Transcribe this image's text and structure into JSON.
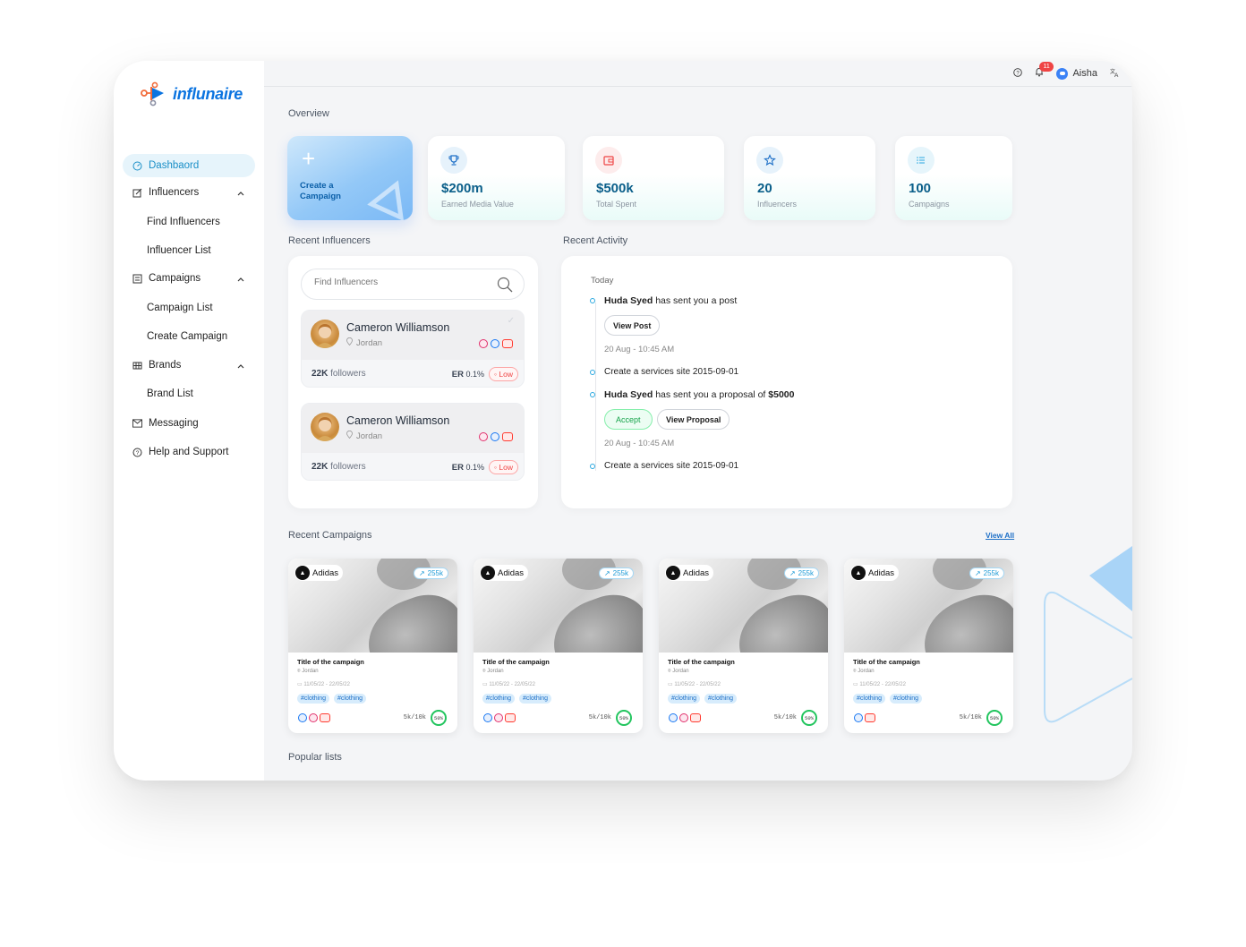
{
  "app": {
    "name": "influnaire"
  },
  "sidebar": {
    "items": [
      {
        "label": "Dashbaord"
      },
      {
        "label": "Influencers"
      },
      {
        "label": "Find Influencers"
      },
      {
        "label": "Influencer List"
      },
      {
        "label": "Campaigns"
      },
      {
        "label": "Campaign List"
      },
      {
        "label": "Create Campaign"
      },
      {
        "label": "Brands"
      },
      {
        "label": "Brand List"
      },
      {
        "label": "Messaging"
      },
      {
        "label": "Help and Support"
      }
    ]
  },
  "topbar": {
    "notification_count": "11",
    "user_name": "Aisha"
  },
  "overview": {
    "title": "Overview",
    "create_label": "Create a Campaign",
    "stats": [
      {
        "value": "$200m",
        "label": "Earned Media Value",
        "icon": "trophy-icon"
      },
      {
        "value": "$500k",
        "label": "Total Spent",
        "icon": "wallet-icon"
      },
      {
        "value": "20",
        "label": "Influencers",
        "icon": "star-icon"
      },
      {
        "value": "100",
        "label": "Campaigns",
        "icon": "list-icon"
      }
    ]
  },
  "recent_influencers": {
    "title": "Recent Influencers",
    "search_placeholder": "Find Influencers",
    "cards": [
      {
        "name": "Cameron Williamson",
        "location": "Jordan",
        "followers": "22K",
        "followers_label": "followers",
        "er_label": "ER",
        "er_value": "0.1%",
        "level": "Low"
      },
      {
        "name": "Cameron Williamson",
        "location": "Jordan",
        "followers": "22K",
        "followers_label": "followers",
        "er_label": "ER",
        "er_value": "0.1%",
        "level": "Low"
      }
    ]
  },
  "recent_activity": {
    "title": "Recent Activity",
    "day": "Today",
    "items": [
      {
        "actor": "Huda Syed",
        "text": "has sent you a post",
        "button": "View Post",
        "time": "20 Aug - 10:45 AM"
      },
      {
        "text": "Create a services site 2015-09-01"
      },
      {
        "actor": "Huda Syed",
        "text": "has sent you a proposal of",
        "amount": "$5000",
        "accept": "Accept",
        "button": "View Proposal",
        "time": "20 Aug - 10:45 AM"
      },
      {
        "text": "Create a services site 2015-09-01"
      }
    ]
  },
  "recent_campaigns": {
    "title": "Recent Campaigns",
    "view_all": "View All",
    "cards": [
      {
        "brand": "Adidas",
        "reach": "255k",
        "title": "Title of the campaign",
        "location": "Jordan",
        "dates": "11/05/22 - 22/05/22",
        "tags": [
          "#clothing",
          "#clothing"
        ],
        "progress": "5k/10k",
        "percent": "50%"
      },
      {
        "brand": "Adidas",
        "reach": "255k",
        "title": "Title of the campaign",
        "location": "Jordan",
        "dates": "11/05/22 - 22/05/22",
        "tags": [
          "#clothing",
          "#clothing"
        ],
        "progress": "5k/10k",
        "percent": "50%"
      },
      {
        "brand": "Adidas",
        "reach": "255k",
        "title": "Title of the campaign",
        "location": "Jordan",
        "dates": "11/05/22 - 22/05/22",
        "tags": [
          "#clothing",
          "#clothing"
        ],
        "progress": "5k/10k",
        "percent": "50%"
      },
      {
        "brand": "Adidas",
        "reach": "255k",
        "title": "Title of the campaign",
        "location": "Jordan",
        "dates": "11/05/22 - 22/05/22",
        "tags": [
          "#clothing",
          "#clothing"
        ],
        "progress": "5k/10k",
        "percent": "50%"
      }
    ]
  },
  "popular_lists": {
    "title": "Popular lists"
  },
  "colors": {
    "accent": "#1a8fc7",
    "brand": "#0b74e0",
    "danger": "#ef4444",
    "success": "#22c55e"
  }
}
